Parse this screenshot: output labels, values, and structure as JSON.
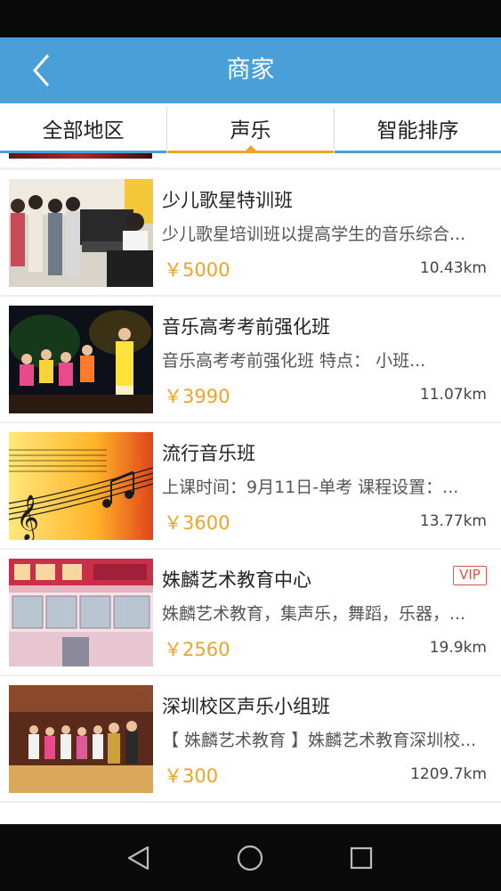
{
  "header": {
    "title": "商家",
    "back_icon": "chevron-left-icon"
  },
  "filters": [
    {
      "label": "全部地区",
      "active": false
    },
    {
      "label": "声乐",
      "active": true
    },
    {
      "label": "智能排序",
      "active": false
    }
  ],
  "colors": {
    "accent": "#4a9fd9",
    "active_tab": "#f0a229",
    "price": "#f0a229",
    "vip": "#d9534f"
  },
  "merchants": [
    {
      "title": "少儿歌星特训班",
      "desc": "少儿歌星培训班以提高学生的音乐综合...",
      "price": "￥5000",
      "distance": "10.43km",
      "vip": null
    },
    {
      "title": "音乐高考考前强化班",
      "desc": " 音乐高考考前强化班    特点：  小班...",
      "price": "￥3990",
      "distance": "11.07km",
      "vip": null
    },
    {
      "title": "流行音乐班",
      "desc": " 上课时间：9月11日-单考  课程设置：...",
      "price": "￥3600",
      "distance": "13.77km",
      "vip": null
    },
    {
      "title": "姝麟艺术教育中心",
      "desc": "姝麟艺术教育，集声乐，舞蹈，乐器，...",
      "price": "￥2560",
      "distance": "19.9km",
      "vip": "VIP"
    },
    {
      "title": "深圳校区声乐小组班",
      "desc": "【 姝麟艺术教育 】姝麟艺术教育深圳校...",
      "price": "￥300",
      "distance": "1209.7km",
      "vip": null
    }
  ],
  "nav": {
    "back_icon": "triangle-back-icon",
    "home_icon": "circle-home-icon",
    "recents_icon": "square-recents-icon"
  }
}
